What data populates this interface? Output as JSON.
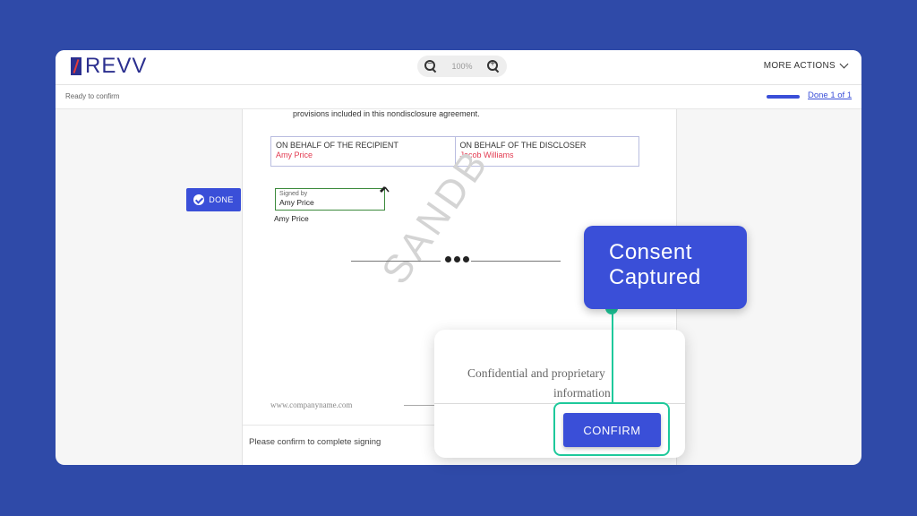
{
  "app": {
    "logo_text": "REVV"
  },
  "topbar": {
    "zoom_level": "100%",
    "more_actions_label": "MORE ACTIONS"
  },
  "statusbar": {
    "status_text": "Ready to confirm",
    "done_progress": "Done 1 of 1",
    "progress_fraction": 1.0
  },
  "document": {
    "provisions_text": "provisions included in this nondisclosure agreement.",
    "recipient_heading": "ON BEHALF OF THE RECIPIENT",
    "recipient_name": "Amy Price",
    "discloser_heading": "ON BEHALF OF THE DISCLOSER",
    "discloser_name": "Jacob Williams",
    "signed_by_label": "Signed by",
    "signature_name": "Amy Price",
    "signer_name": "Amy Price",
    "watermark": "SANDB",
    "footer_url": "www.companyname.com",
    "confirm_hint": "Please confirm to complete signing"
  },
  "done_badge_label": "DONE",
  "zoomed": {
    "confidential_line1": "Confidential and proprietary",
    "confidential_line2": "information",
    "confirm_label": "CONFIRM"
  },
  "callout": {
    "line1": "Consent",
    "line2": "Captured"
  },
  "colors": {
    "background": "#2f4aa8",
    "accent": "#3a4fd8",
    "highlight": "#1ec99b",
    "name_red": "#e23a50"
  }
}
